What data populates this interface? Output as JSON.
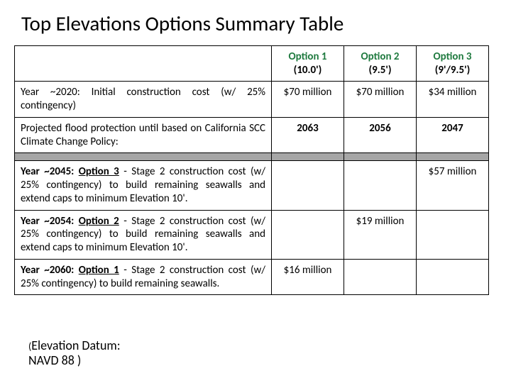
{
  "title": "Top Elevations Options Summary Table",
  "options": [
    {
      "name": "Option 1",
      "sub": "(10.0')"
    },
    {
      "name": "Option 2",
      "sub": "(9.5')"
    },
    {
      "name": "Option 3",
      "sub": "(9'/9.5')"
    }
  ],
  "rows": {
    "r1": {
      "label_a": "Year ~2020:",
      "label_b": " Initial construction cost (w/ 25% contingency)",
      "opt1": "$70 million",
      "opt2": "$70 million",
      "opt3": "$34 million"
    },
    "r2": {
      "label": "Projected flood protection until based on California SCC Climate Change Policy:",
      "opt1": "2063",
      "opt2": "2056",
      "opt3": "2047"
    },
    "r3": {
      "year": "Year ~2045: ",
      "opt": "Option 3",
      "rest": " - Stage 2 construction cost (w/ 25% contingency) to build remaining seawalls and extend caps to minimum Elevation 10'.",
      "opt3": "$57 million"
    },
    "r4": {
      "year": "Year ~2054: ",
      "opt": "Option 2",
      "rest": " - Stage 2 construction cost (w/ 25% contingency) to build remaining seawalls and extend caps to minimum Elevation 10'.",
      "opt2": "$19 million"
    },
    "r5": {
      "year": "Year ~2060: ",
      "opt": "Option 1",
      "rest": " - Stage 2 construction cost (w/ 25% contingency) to build remaining seawalls.",
      "opt1": "$16 million"
    }
  },
  "footer": {
    "line1_a": "(",
    "line1_b": "Elevation Datum:",
    "line2": "NAVD 88 )"
  }
}
